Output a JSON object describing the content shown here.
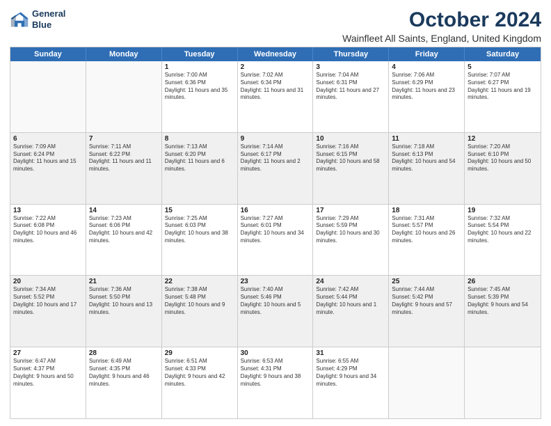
{
  "logo": {
    "line1": "General",
    "line2": "Blue"
  },
  "title": "October 2024",
  "location": "Wainfleet All Saints, England, United Kingdom",
  "header_days": [
    "Sunday",
    "Monday",
    "Tuesday",
    "Wednesday",
    "Thursday",
    "Friday",
    "Saturday"
  ],
  "rows": [
    [
      {
        "day": "",
        "sunrise": "",
        "sunset": "",
        "daylight": "",
        "empty": true
      },
      {
        "day": "",
        "sunrise": "",
        "sunset": "",
        "daylight": "",
        "empty": true
      },
      {
        "day": "1",
        "sunrise": "Sunrise: 7:00 AM",
        "sunset": "Sunset: 6:36 PM",
        "daylight": "Daylight: 11 hours and 35 minutes."
      },
      {
        "day": "2",
        "sunrise": "Sunrise: 7:02 AM",
        "sunset": "Sunset: 6:34 PM",
        "daylight": "Daylight: 11 hours and 31 minutes."
      },
      {
        "day": "3",
        "sunrise": "Sunrise: 7:04 AM",
        "sunset": "Sunset: 6:31 PM",
        "daylight": "Daylight: 11 hours and 27 minutes."
      },
      {
        "day": "4",
        "sunrise": "Sunrise: 7:06 AM",
        "sunset": "Sunset: 6:29 PM",
        "daylight": "Daylight: 11 hours and 23 minutes."
      },
      {
        "day": "5",
        "sunrise": "Sunrise: 7:07 AM",
        "sunset": "Sunset: 6:27 PM",
        "daylight": "Daylight: 11 hours and 19 minutes."
      }
    ],
    [
      {
        "day": "6",
        "sunrise": "Sunrise: 7:09 AM",
        "sunset": "Sunset: 6:24 PM",
        "daylight": "Daylight: 11 hours and 15 minutes."
      },
      {
        "day": "7",
        "sunrise": "Sunrise: 7:11 AM",
        "sunset": "Sunset: 6:22 PM",
        "daylight": "Daylight: 11 hours and 11 minutes."
      },
      {
        "day": "8",
        "sunrise": "Sunrise: 7:13 AM",
        "sunset": "Sunset: 6:20 PM",
        "daylight": "Daylight: 11 hours and 6 minutes."
      },
      {
        "day": "9",
        "sunrise": "Sunrise: 7:14 AM",
        "sunset": "Sunset: 6:17 PM",
        "daylight": "Daylight: 11 hours and 2 minutes."
      },
      {
        "day": "10",
        "sunrise": "Sunrise: 7:16 AM",
        "sunset": "Sunset: 6:15 PM",
        "daylight": "Daylight: 10 hours and 58 minutes."
      },
      {
        "day": "11",
        "sunrise": "Sunrise: 7:18 AM",
        "sunset": "Sunset: 6:13 PM",
        "daylight": "Daylight: 10 hours and 54 minutes."
      },
      {
        "day": "12",
        "sunrise": "Sunrise: 7:20 AM",
        "sunset": "Sunset: 6:10 PM",
        "daylight": "Daylight: 10 hours and 50 minutes."
      }
    ],
    [
      {
        "day": "13",
        "sunrise": "Sunrise: 7:22 AM",
        "sunset": "Sunset: 6:08 PM",
        "daylight": "Daylight: 10 hours and 46 minutes."
      },
      {
        "day": "14",
        "sunrise": "Sunrise: 7:23 AM",
        "sunset": "Sunset: 6:06 PM",
        "daylight": "Daylight: 10 hours and 42 minutes."
      },
      {
        "day": "15",
        "sunrise": "Sunrise: 7:25 AM",
        "sunset": "Sunset: 6:03 PM",
        "daylight": "Daylight: 10 hours and 38 minutes."
      },
      {
        "day": "16",
        "sunrise": "Sunrise: 7:27 AM",
        "sunset": "Sunset: 6:01 PM",
        "daylight": "Daylight: 10 hours and 34 minutes."
      },
      {
        "day": "17",
        "sunrise": "Sunrise: 7:29 AM",
        "sunset": "Sunset: 5:59 PM",
        "daylight": "Daylight: 10 hours and 30 minutes."
      },
      {
        "day": "18",
        "sunrise": "Sunrise: 7:31 AM",
        "sunset": "Sunset: 5:57 PM",
        "daylight": "Daylight: 10 hours and 26 minutes."
      },
      {
        "day": "19",
        "sunrise": "Sunrise: 7:32 AM",
        "sunset": "Sunset: 5:54 PM",
        "daylight": "Daylight: 10 hours and 22 minutes."
      }
    ],
    [
      {
        "day": "20",
        "sunrise": "Sunrise: 7:34 AM",
        "sunset": "Sunset: 5:52 PM",
        "daylight": "Daylight: 10 hours and 17 minutes."
      },
      {
        "day": "21",
        "sunrise": "Sunrise: 7:36 AM",
        "sunset": "Sunset: 5:50 PM",
        "daylight": "Daylight: 10 hours and 13 minutes."
      },
      {
        "day": "22",
        "sunrise": "Sunrise: 7:38 AM",
        "sunset": "Sunset: 5:48 PM",
        "daylight": "Daylight: 10 hours and 9 minutes."
      },
      {
        "day": "23",
        "sunrise": "Sunrise: 7:40 AM",
        "sunset": "Sunset: 5:46 PM",
        "daylight": "Daylight: 10 hours and 5 minutes."
      },
      {
        "day": "24",
        "sunrise": "Sunrise: 7:42 AM",
        "sunset": "Sunset: 5:44 PM",
        "daylight": "Daylight: 10 hours and 1 minute."
      },
      {
        "day": "25",
        "sunrise": "Sunrise: 7:44 AM",
        "sunset": "Sunset: 5:42 PM",
        "daylight": "Daylight: 9 hours and 57 minutes."
      },
      {
        "day": "26",
        "sunrise": "Sunrise: 7:45 AM",
        "sunset": "Sunset: 5:39 PM",
        "daylight": "Daylight: 9 hours and 54 minutes."
      }
    ],
    [
      {
        "day": "27",
        "sunrise": "Sunrise: 6:47 AM",
        "sunset": "Sunset: 4:37 PM",
        "daylight": "Daylight: 9 hours and 50 minutes."
      },
      {
        "day": "28",
        "sunrise": "Sunrise: 6:49 AM",
        "sunset": "Sunset: 4:35 PM",
        "daylight": "Daylight: 9 hours and 46 minutes."
      },
      {
        "day": "29",
        "sunrise": "Sunrise: 6:51 AM",
        "sunset": "Sunset: 4:33 PM",
        "daylight": "Daylight: 9 hours and 42 minutes."
      },
      {
        "day": "30",
        "sunrise": "Sunrise: 6:53 AM",
        "sunset": "Sunset: 4:31 PM",
        "daylight": "Daylight: 9 hours and 38 minutes."
      },
      {
        "day": "31",
        "sunrise": "Sunrise: 6:55 AM",
        "sunset": "Sunset: 4:29 PM",
        "daylight": "Daylight: 9 hours and 34 minutes."
      },
      {
        "day": "",
        "sunrise": "",
        "sunset": "",
        "daylight": "",
        "empty": true
      },
      {
        "day": "",
        "sunrise": "",
        "sunset": "",
        "daylight": "",
        "empty": true
      }
    ]
  ]
}
